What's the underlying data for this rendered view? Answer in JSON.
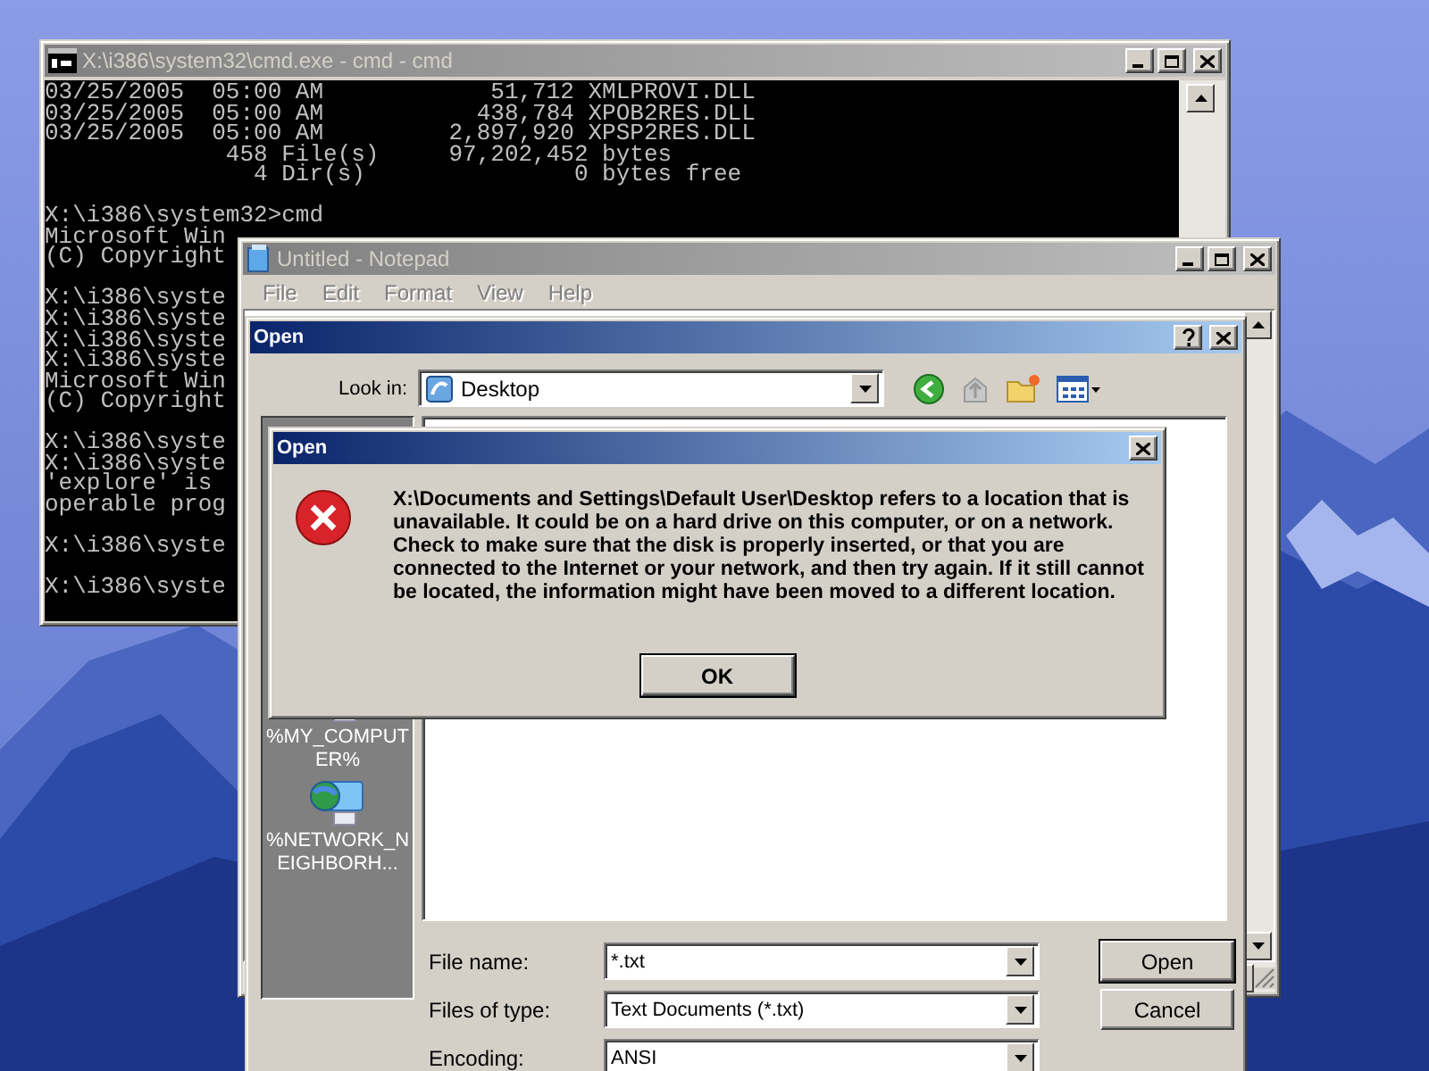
{
  "console_window": {
    "title": "X:\\i386\\system32\\cmd.exe - cmd - cmd",
    "blocks": [
      [
        "03/25/2005  05:00 AM            51,712 XMLPROVI.DLL",
        "03/25/2005  05:00 AM           438,784 XPOB2RES.DLL",
        "03/25/2005  05:00 AM         2,897,920 XPSP2RES.DLL",
        "             458 File(s)     97,202,452 bytes",
        "               4 Dir(s)               0 bytes free"
      ],
      [
        "X:\\i386\\system32>cmd",
        "Microsoft Win",
        "(C) Copyright"
      ],
      [
        "X:\\i386\\syste",
        "X:\\i386\\syste",
        "X:\\i386\\syste",
        "X:\\i386\\syste",
        "Microsoft Win",
        "(C) Copyright"
      ],
      [
        "X:\\i386\\syste",
        "X:\\i386\\syste",
        "'explore' is",
        "operable prog"
      ],
      [
        "X:\\i386\\syste"
      ],
      [
        "X:\\i386\\syste"
      ]
    ]
  },
  "notepad_window": {
    "title": "Untitled - Notepad",
    "menu": [
      "File",
      "Edit",
      "Format",
      "View",
      "Help"
    ]
  },
  "open_dialog": {
    "title": "Open",
    "look_in": {
      "label": "Look in:",
      "value": "Desktop"
    },
    "places": [
      {
        "label": "%MY_COMPUTER%"
      },
      {
        "label": "%NETWORK_NEIGHBORH..."
      }
    ],
    "fields": [
      {
        "label": "File name:",
        "value": "*.txt"
      },
      {
        "label": "Files of type:",
        "value": "Text Documents (*.txt)"
      },
      {
        "label": "Encoding:",
        "value": "ANSI"
      }
    ],
    "buttons": [
      "Open",
      "Cancel"
    ]
  },
  "error_dialog": {
    "title": "Open",
    "message": "X:\\Documents and Settings\\Default User\\Desktop refers to a location that is unavailable. It could be on a hard drive on this computer, or on a network. Check to make sure that the disk is properly inserted, or that you are connected to the Internet or your network, and then try again. If it still cannot be located, the information might have been moved to a different location.",
    "button": "OK"
  }
}
